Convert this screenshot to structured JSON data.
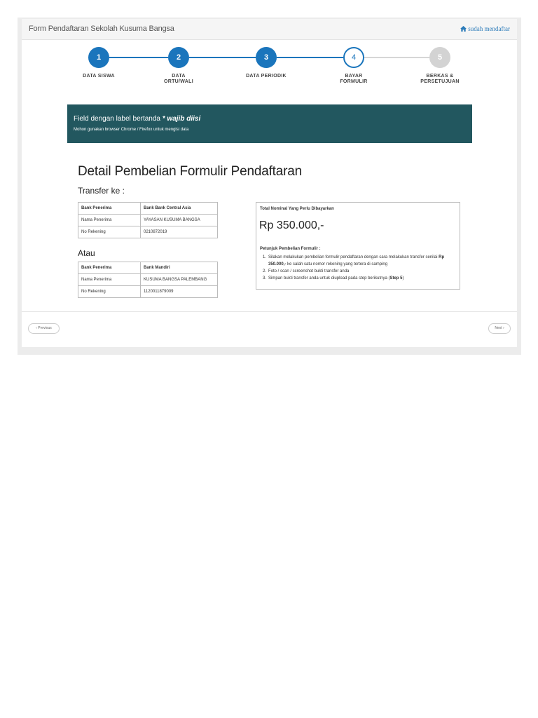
{
  "header": {
    "title": "Form Pendaftaran Sekolah Kusuma Bangsa",
    "link": "sudah mendaftar"
  },
  "steps": [
    {
      "number": "1",
      "label_line1": "DATA SISWA",
      "label_line2": "",
      "state": "done"
    },
    {
      "number": "2",
      "label_line1": "DATA",
      "label_line2": "ORTU/WALI",
      "state": "done"
    },
    {
      "number": "3",
      "label_line1": "DATA PERIODIK",
      "label_line2": "",
      "state": "done"
    },
    {
      "number": "4",
      "label_line1": "BAYAR",
      "label_line2": "FORMULIR",
      "state": "current"
    },
    {
      "number": "5",
      "label_line1": "BERKAS &",
      "label_line2": "PERSETUJUAN",
      "state": "future"
    }
  ],
  "alert": {
    "main_prefix": "Field dengan label bertanda ",
    "main_emphasis": "* wajib diisi",
    "sub": "Mohon gunakan browser Chrome / Firefox untuk mengisi data"
  },
  "content": {
    "title": "Detail Pembelian Formulir Pendaftaran",
    "transfer_label": "Transfer ke :",
    "or_label": "Atau",
    "bank1": [
      [
        "Bank Penerima",
        "Bank Bank Central Asia"
      ],
      [
        "Nama Penerima",
        "YAYASAN KUSUMA BANGSA"
      ],
      [
        "No Rekening",
        "0210872019"
      ]
    ],
    "bank2": [
      [
        "Bank Penerima",
        "Bank Mandiri"
      ],
      [
        "Nama Penerima",
        "KUSUMA BANGSA PALEMBANG"
      ],
      [
        "No Rekening",
        "1120011879009"
      ]
    ],
    "total_label": "Total Nominal Yang Perlu Dibayarkan",
    "total_amount": "Rp 350.000,-",
    "instructions_title": "Petunjuk Pembelian Formulir :",
    "instructions": {
      "i1_a": "Silakan melakukan pembelian formulir pendaftaran dengan cara melakukan transfer senilai ",
      "i1_b": "Rp 350.000,-",
      "i1_c": " ke salah satu nomor rekening yang tertera di samping",
      "i2": "Foto / scan / screenshot bukti transfer anda",
      "i3_a": "Simpan bukti transfer anda untuk diupload pada step berikutnya (",
      "i3_b": "Step 5",
      "i3_c": ")"
    }
  },
  "nav": {
    "previous": "‹ Previous",
    "next": "Next ›"
  }
}
